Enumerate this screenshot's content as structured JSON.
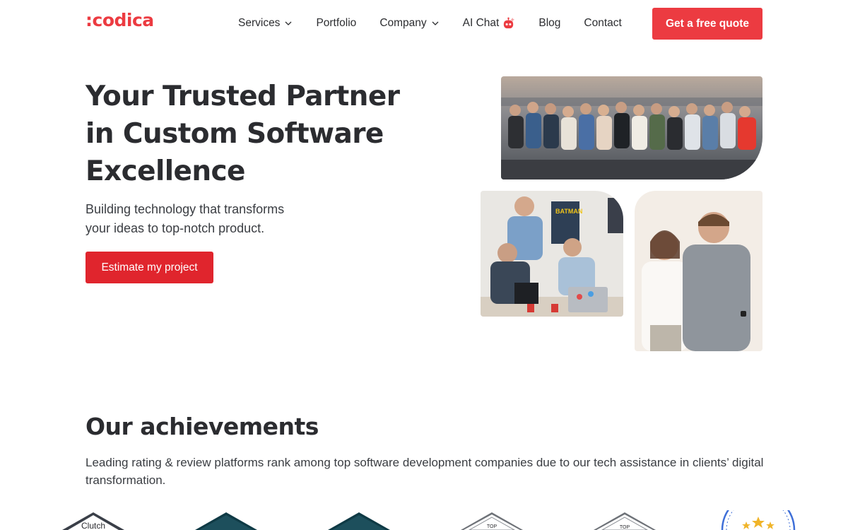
{
  "brand": {
    "logo": ":codica",
    "accent": "#ec3b41",
    "button": "#e0252d"
  },
  "nav": {
    "items": [
      {
        "label": "Services",
        "dropdown": true
      },
      {
        "label": "Portfolio",
        "dropdown": false
      },
      {
        "label": "Company",
        "dropdown": true
      },
      {
        "label": "AI Chat",
        "dropdown": false,
        "icon": "ai-chat-icon"
      },
      {
        "label": "Blog",
        "dropdown": false
      },
      {
        "label": "Contact",
        "dropdown": false
      }
    ],
    "cta": "Get a free quote"
  },
  "hero": {
    "title_line1": "Your Trusted Partner",
    "title_line2": "in Custom Software",
    "title_line3": "Excellence",
    "subtitle_line1": "Building technology that transforms",
    "subtitle_line2": "your ideas to top-notch product.",
    "cta": "Estimate my project",
    "photos": [
      "team-photo",
      "office-photo",
      "founders-photo"
    ]
  },
  "achievements": {
    "title": "Our achievements",
    "text": "Leading rating & review platforms rank among top software development companies due to our tech assistance in clients’ digital transformation.",
    "badges": [
      {
        "label": "Clutch",
        "icon": "clutch-badge-icon"
      },
      {
        "label": "",
        "icon": "dark-badge-icon"
      },
      {
        "label": "",
        "icon": "dark-badge-icon"
      },
      {
        "label": "TOP",
        "icon": "top-badge-icon"
      },
      {
        "label": "TOP",
        "icon": "top-badge-icon"
      },
      {
        "label": "",
        "icon": "stars-badge-icon"
      }
    ]
  }
}
